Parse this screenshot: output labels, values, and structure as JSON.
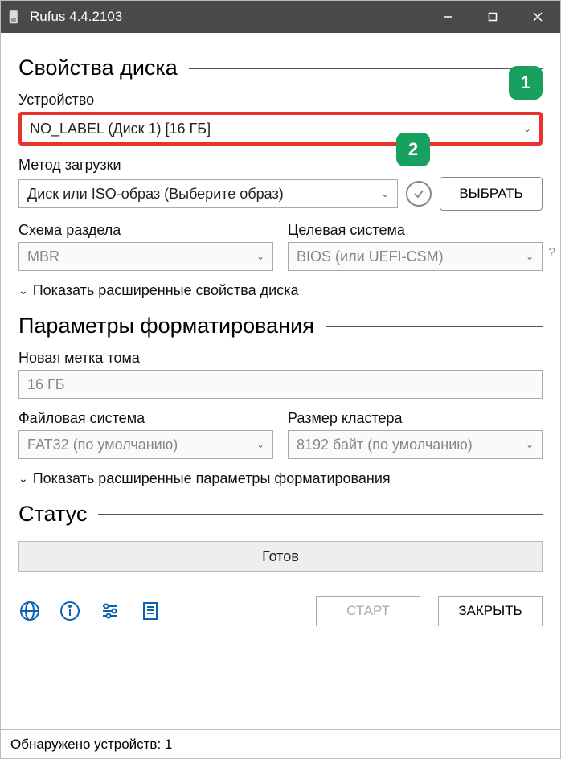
{
  "window": {
    "title": "Rufus 4.4.2103"
  },
  "sections": {
    "drive_properties": "Свойства диска",
    "format_options": "Параметры форматирования",
    "status": "Статус"
  },
  "device": {
    "label": "Устройство",
    "value": "NO_LABEL (Диск 1) [16 ГБ]"
  },
  "boot": {
    "label": "Метод загрузки",
    "value": "Диск или ISO-образ (Выберите образ)",
    "select_button": "ВЫБРАТЬ"
  },
  "partition": {
    "label": "Схема раздела",
    "value": "MBR"
  },
  "target": {
    "label": "Целевая система",
    "value": "BIOS (или UEFI-CSM)"
  },
  "advanced_drive": "Показать расширенные свойства диска",
  "volume": {
    "label": "Новая метка тома",
    "value": "16 ГБ"
  },
  "filesystem": {
    "label": "Файловая система",
    "value": "FAT32 (по умолчанию)"
  },
  "cluster": {
    "label": "Размер кластера",
    "value": "8192 байт (по умолчанию)"
  },
  "advanced_format": "Показать расширенные параметры форматирования",
  "status_text": "Готов",
  "buttons": {
    "start": "СТАРТ",
    "close": "ЗАКРЫТЬ"
  },
  "footer": "Обнаружено устройств: 1",
  "badges": {
    "one": "1",
    "two": "2"
  }
}
